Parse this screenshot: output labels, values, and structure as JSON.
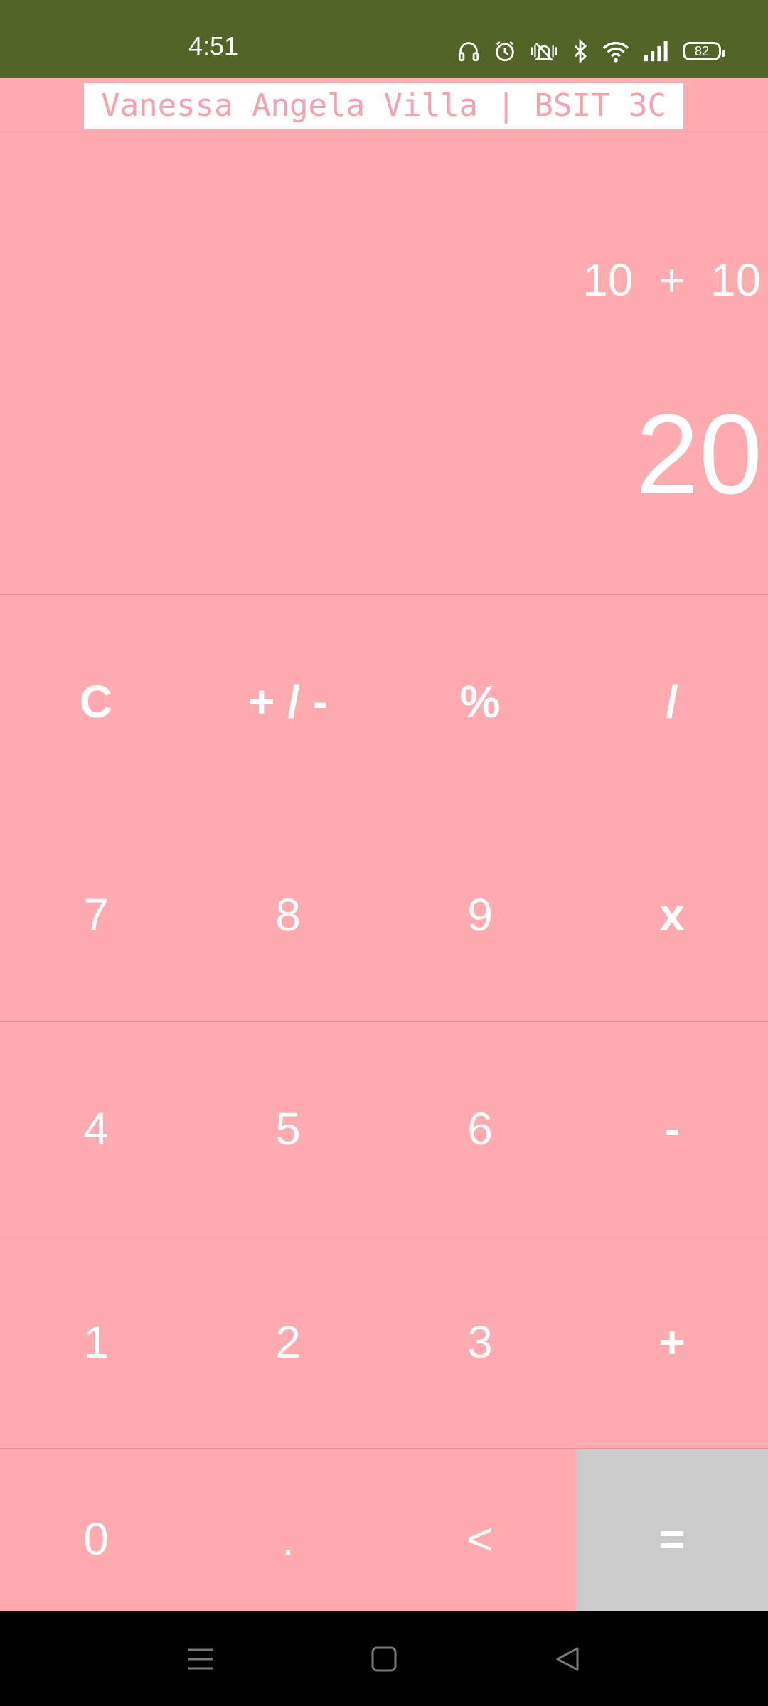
{
  "status_bar": {
    "time": "4:51",
    "battery": "82",
    "icons": [
      "headphones-icon",
      "alarm-icon",
      "vibrate-icon",
      "bluetooth-icon",
      "wifi-icon",
      "signal-icon",
      "battery-icon"
    ]
  },
  "app": {
    "title": "Vanessa Angela Villa | BSIT 3C"
  },
  "display": {
    "expression": "10  +  10",
    "result": "20"
  },
  "keypad": {
    "row1": [
      "C",
      "+ / -",
      "%",
      "/"
    ],
    "row2": [
      "7",
      "8",
      "9",
      "x"
    ],
    "row3": [
      "4",
      "5",
      "6",
      "-"
    ],
    "row4": [
      "1",
      "2",
      "3",
      "+"
    ],
    "row5": [
      "0",
      ".",
      "<",
      "="
    ]
  },
  "colors": {
    "status_bar": "#526526",
    "background": "#ffabaf",
    "equals_key": "#cbcbcb",
    "title_text": "#f4a2ab"
  },
  "nav_bar": {
    "icons": [
      "menu-icon",
      "home-icon",
      "back-icon"
    ]
  }
}
